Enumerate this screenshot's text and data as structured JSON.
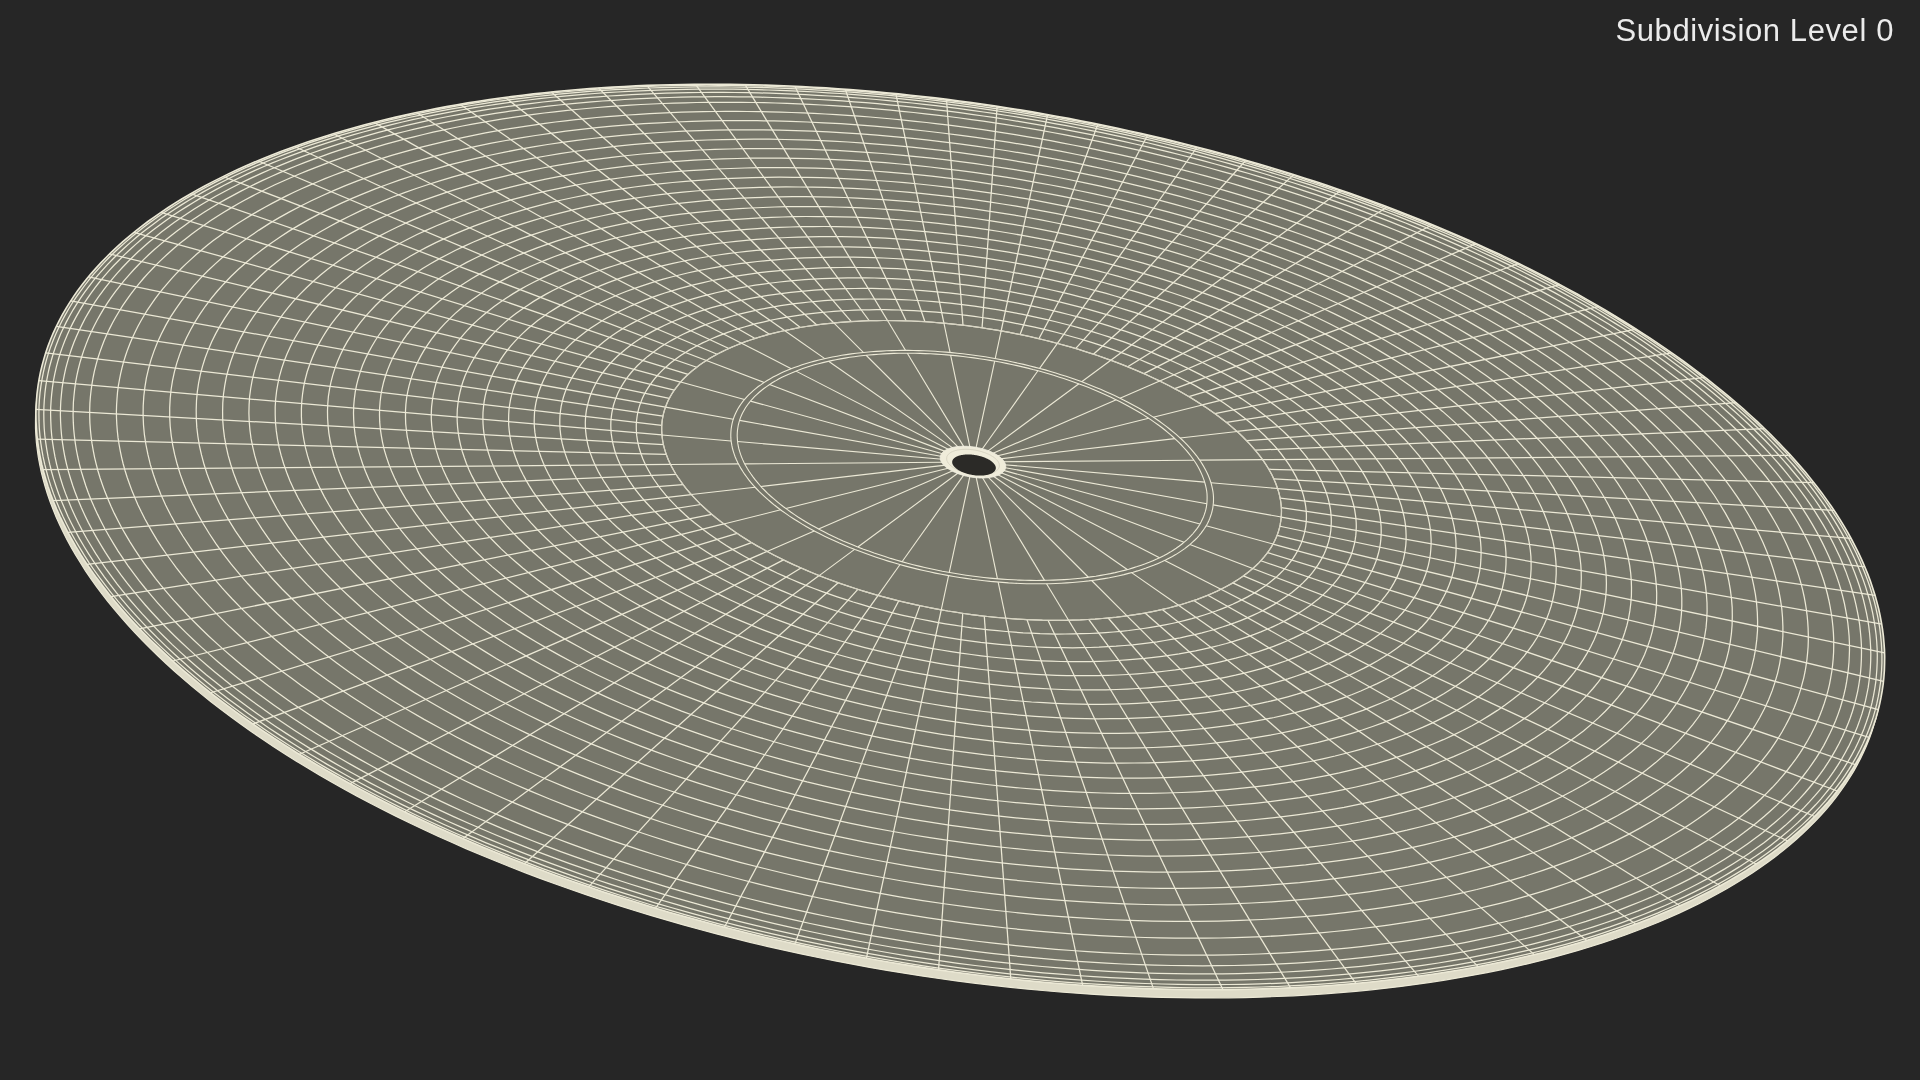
{
  "viewport": {
    "overlay_text": "Subdivision Level 0"
  }
}
